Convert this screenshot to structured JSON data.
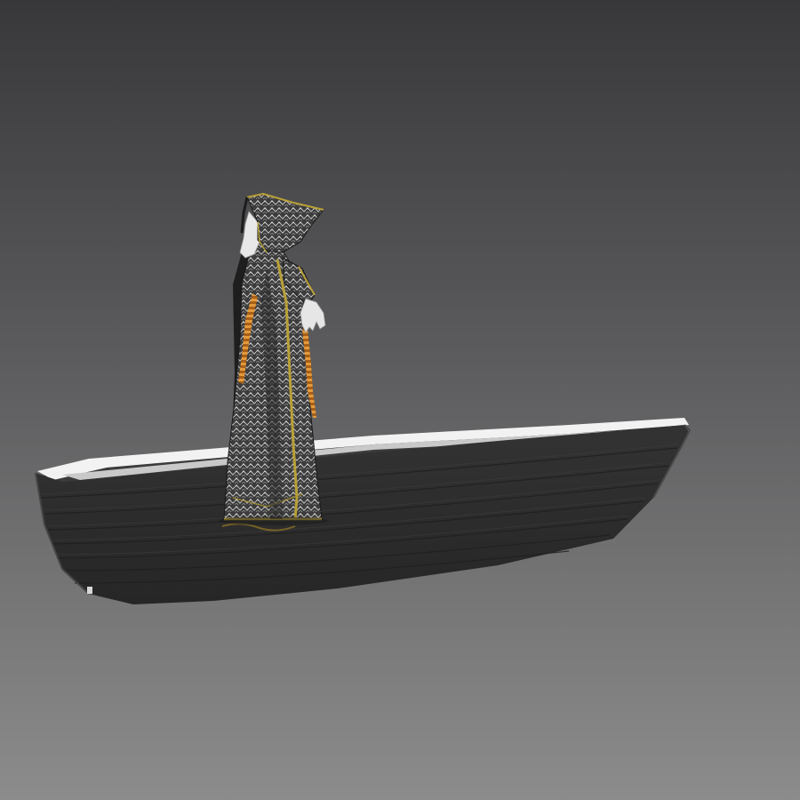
{
  "scene": {
    "subject": "hooded-figure-in-rowboat",
    "colors": {
      "background_top": "#3a3a3c",
      "background_bottom": "#8a8a8a",
      "hull": "#2f2f2f",
      "hull_shade": "#232323",
      "interior": "#3a3a3a",
      "gunwale": "#f4f4f4",
      "robe": "#4a4a4a",
      "robe_pattern": "#cfcfcf",
      "trim_gold": "#b8a038",
      "cord_orange": "#d98a2a",
      "skin": "#e6e6e6"
    }
  }
}
